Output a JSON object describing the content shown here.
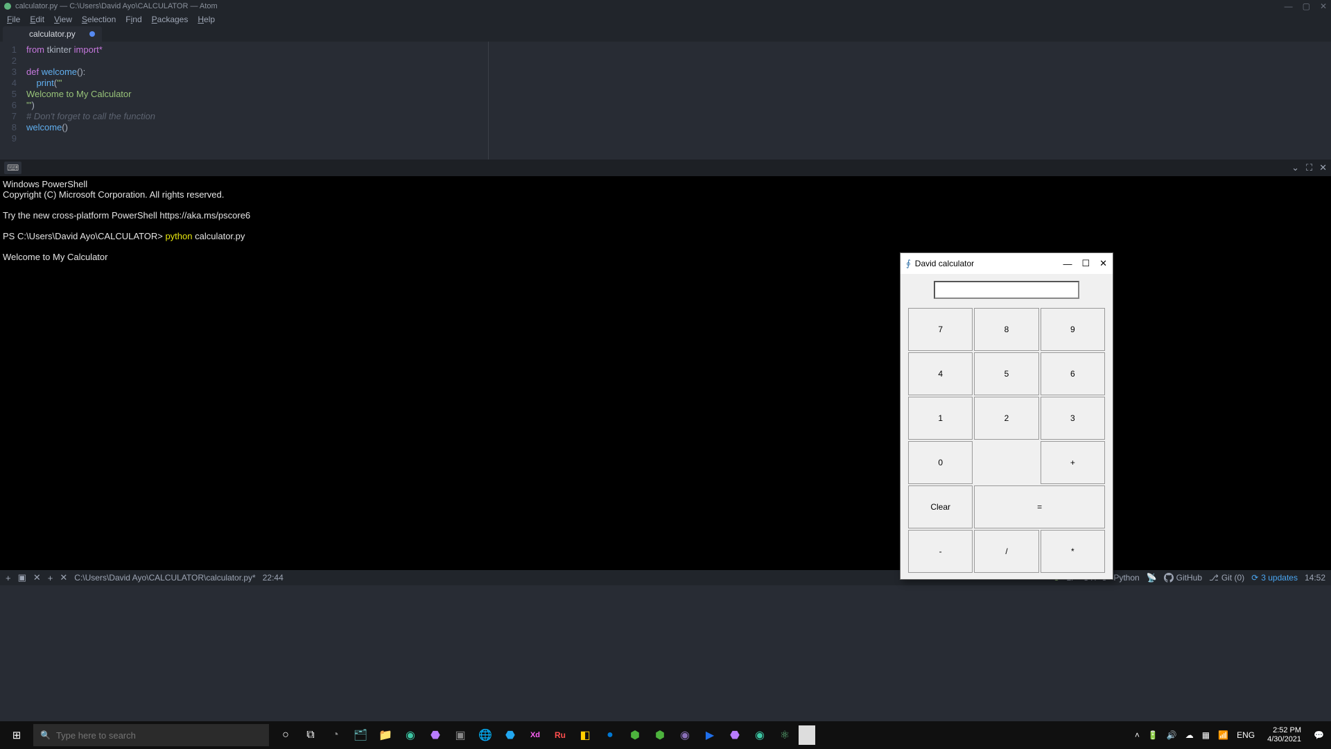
{
  "window": {
    "title": "calculator.py — C:\\Users\\David Ayo\\CALCULATOR — Atom"
  },
  "menu": [
    "File",
    "Edit",
    "View",
    "Selection",
    "Find",
    "Packages",
    "Help"
  ],
  "tab": {
    "name": "calculator.py",
    "modified": true
  },
  "editor": {
    "lines": [
      1,
      2,
      3,
      4,
      5,
      6,
      7,
      8,
      9
    ],
    "l1_from": "from",
    "l1_mod": "tkinter",
    "l1_imp": "import",
    "l1_star": "*",
    "l3_def": "def",
    "l3_fn": "welcome",
    "l3_paren": "():",
    "l4_indent": "    ",
    "l4_print": "print",
    "l4_open": "(",
    "l4_str": "'''",
    "l5_str": "Welcome to My Calculator",
    "l6_str": "'''",
    "l6_close": ")",
    "l7_cmt": "# Don't forget to call the function",
    "l8_fn": "welcome",
    "l8_call": "()"
  },
  "terminal": {
    "l1": "Windows PowerShell",
    "l2": "Copyright (C) Microsoft Corporation. All rights reserved.",
    "l3": "",
    "l4": "Try the new cross-platform PowerShell https://aka.ms/pscore6",
    "l5": "",
    "l6_prompt": "PS C:\\Users\\David Ayo\\CALCULATOR> ",
    "l6_cmd": "python",
    "l6_arg": " calculator.py",
    "l7": "",
    "l8": "Welcome to My Calculator"
  },
  "status": {
    "path": "C:\\Users\\David Ayo\\CALCULATOR\\calculator.py*",
    "pos": "22:44",
    "lf": "LF",
    "enc": "UTF-8",
    "lang": "Python",
    "github": "GitHub",
    "git": "Git (0)",
    "updates": "3 updates",
    "time": "14:52"
  },
  "taskbar": {
    "search_placeholder": "Type here to search",
    "time": "2:52 PM",
    "date": "4/30/2021"
  },
  "calc": {
    "title": "David calculator",
    "buttons": {
      "7": "7",
      "8": "8",
      "9": "9",
      "4": "4",
      "5": "5",
      "6": "6",
      "1": "1",
      "2": "2",
      "3": "3",
      "0": "0",
      "plus": "+",
      "clear": "Clear",
      "eq": "=",
      "minus": "-",
      "div": "/",
      "mul": "*"
    }
  }
}
